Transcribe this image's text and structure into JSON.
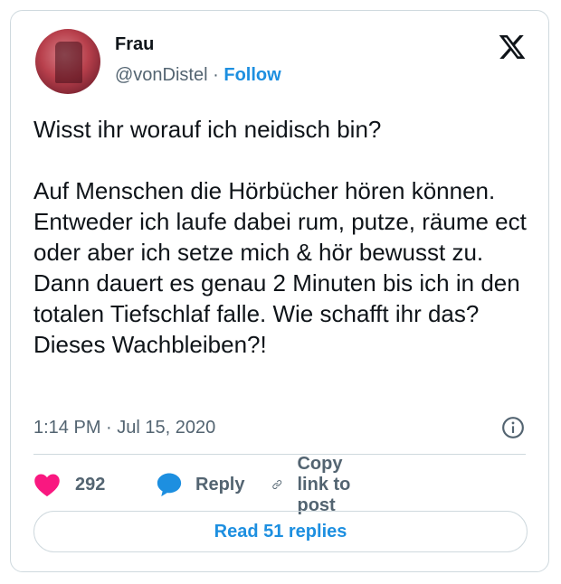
{
  "author": {
    "name": "Frau",
    "handle": "@vonDistel",
    "separator": "·",
    "follow_label": "Follow"
  },
  "tweet": {
    "text": "Wisst ihr worauf ich neidisch bin?\n\nAuf Menschen die Hörbücher hören können. Entweder ich laufe dabei rum, putze, räume ect oder aber ich setze mich & hör bewusst zu. Dann dauert es genau 2 Minuten bis ich in den totalen Tiefschlaf falle. Wie schafft ihr das? Dieses Wachbleiben?!",
    "timestamp": "1:14 PM · Jul 15, 2020"
  },
  "actions": {
    "likes": "292",
    "reply_label": "Reply",
    "copy_label": "Copy link to post"
  },
  "read_replies_label": "Read 51 replies",
  "icons": {
    "like": "heart-icon",
    "reply": "speech-bubble-icon",
    "copy": "link-icon",
    "info": "info-icon",
    "brand": "x-logo-icon"
  },
  "colors": {
    "accent": "#1d8fe0",
    "like": "#f91880",
    "muted": "#536471",
    "border": "#cfd9de"
  }
}
